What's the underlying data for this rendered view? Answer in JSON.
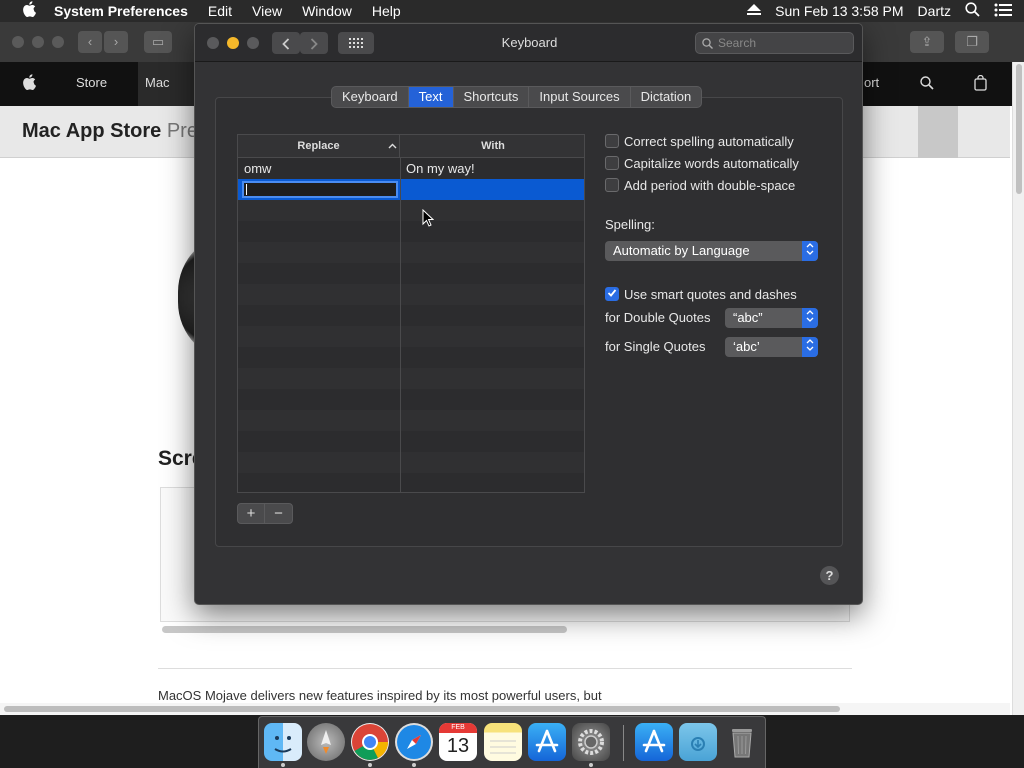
{
  "menubar": {
    "app_name": "System Preferences",
    "menus": [
      "Edit",
      "View",
      "Window",
      "Help"
    ],
    "datetime": "Sun Feb 13  3:58 PM",
    "user": "Dartz"
  },
  "browser": {
    "nav_items": [
      "Store",
      "Mac"
    ],
    "nav_partial": "ort",
    "subnav_title": "Mac App Store",
    "subnav_title_suffix": "Pre",
    "section_heading": "Scre",
    "paragraph": "MacOS Mojave delivers new features inspired by its most powerful users, but"
  },
  "prefs": {
    "window_title": "Keyboard",
    "search_placeholder": "Search",
    "tabs": [
      {
        "label": "Keyboard",
        "active": false
      },
      {
        "label": "Text",
        "active": true
      },
      {
        "label": "Shortcuts",
        "active": false
      },
      {
        "label": "Input Sources",
        "active": false
      },
      {
        "label": "Dictation",
        "active": false
      }
    ],
    "table": {
      "col_replace": "Replace",
      "col_with": "With",
      "rows": [
        {
          "replace": "omw",
          "with": "On my way!"
        }
      ]
    },
    "add_label": "+",
    "remove_label": "−",
    "options": {
      "correct_spelling": {
        "label": "Correct spelling automatically",
        "checked": false
      },
      "capitalize_words": {
        "label": "Capitalize words automatically",
        "checked": false
      },
      "add_period": {
        "label": "Add period with double-space",
        "checked": false
      },
      "smart_quotes": {
        "label": "Use smart quotes and dashes",
        "checked": true
      }
    },
    "spelling_label": "Spelling:",
    "spelling_value": "Automatic by Language",
    "double_quotes_label": "for Double Quotes",
    "double_quotes_value": "“abc”",
    "single_quotes_label": "for Single Quotes",
    "single_quotes_value": "‘abc’",
    "help_label": "?"
  },
  "dock": {
    "calendar_month": "FEB",
    "calendar_day": "13"
  },
  "colors": {
    "accent": "#2462d8",
    "window_bg": "#333335",
    "selection": "#0a5ad2"
  }
}
